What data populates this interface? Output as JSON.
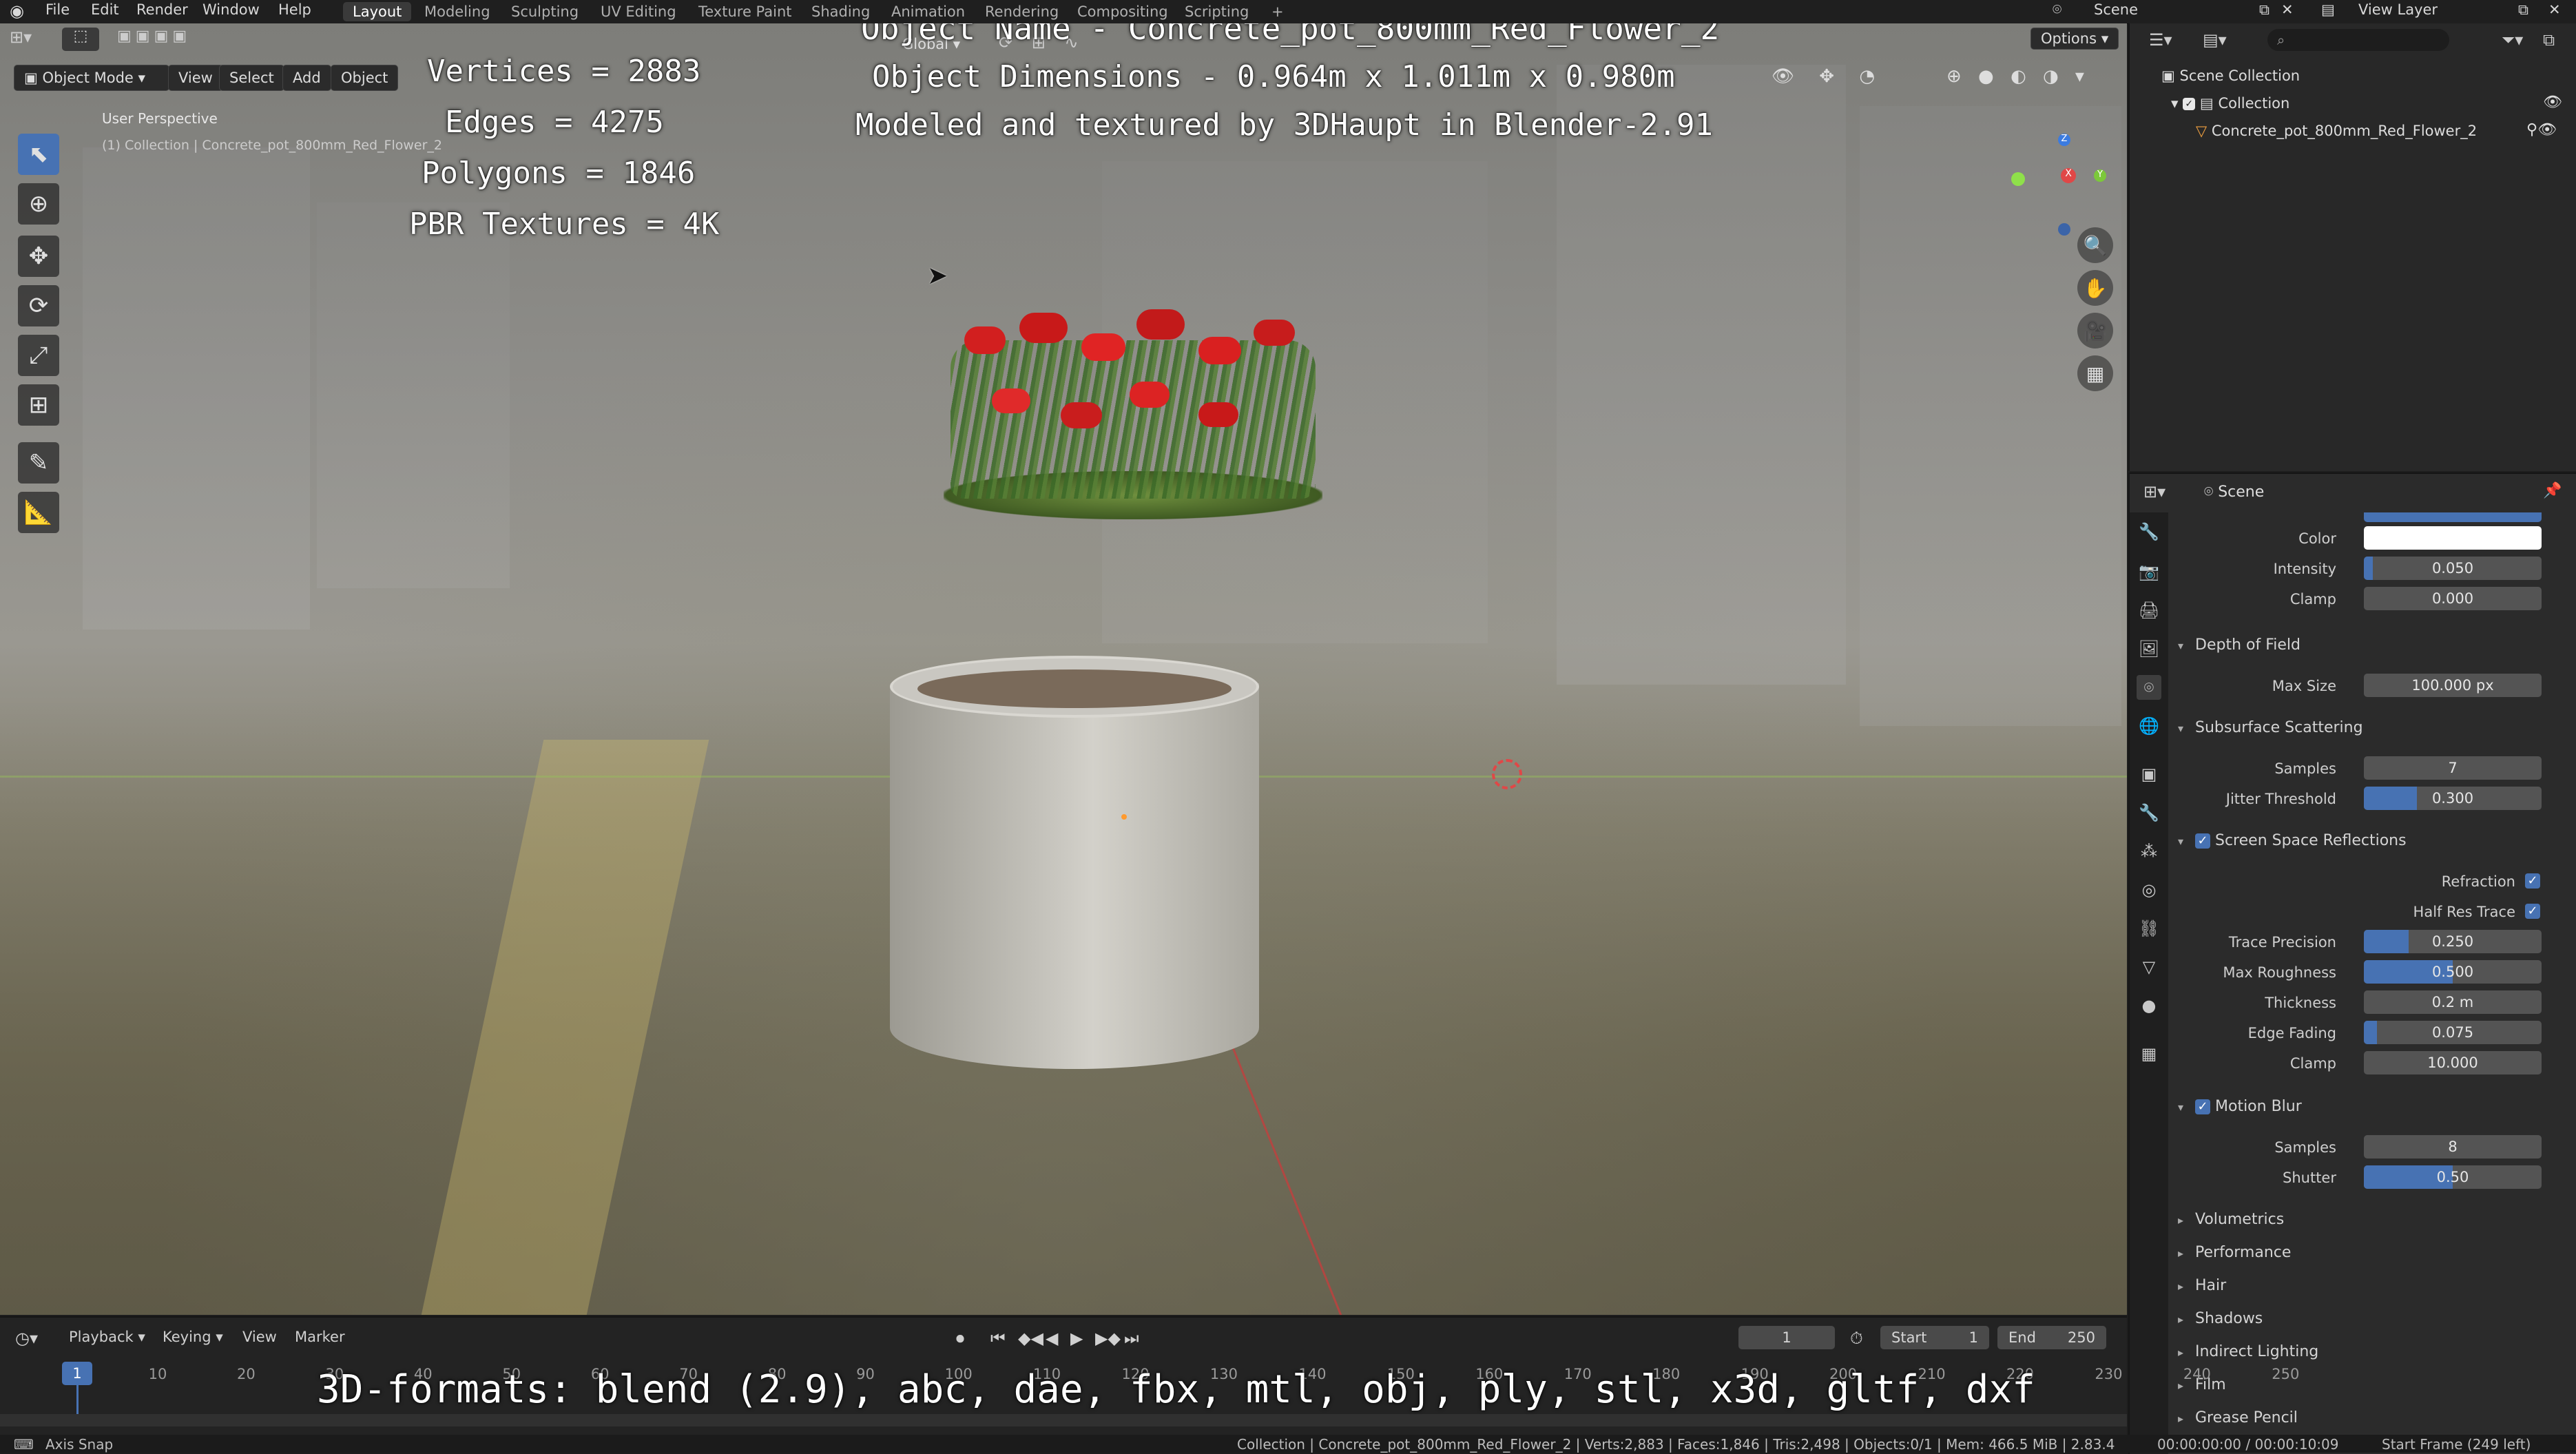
{
  "topbar": {
    "menus": [
      "File",
      "Edit",
      "Render",
      "Window",
      "Help"
    ],
    "workspaces": [
      "Layout",
      "Modeling",
      "Sculpting",
      "UV Editing",
      "Texture Paint",
      "Shading",
      "Animation",
      "Rendering",
      "Compositing",
      "Scripting"
    ],
    "active_workspace": "Layout",
    "add_tab": "+",
    "scene_label": "Scene",
    "view_layer_label": "View Layer"
  },
  "viewport": {
    "mode": "Object Mode",
    "header_menus": [
      "View",
      "Select",
      "Add",
      "Object"
    ],
    "transform_orientation": "Global",
    "options_label": "Options",
    "perspective_label": "User Perspective",
    "collection_label": "(1) Collection | Concrete_pot_800mm_Red_Flower_2",
    "gizmo": {
      "z": "Z",
      "x": "X",
      "y": "Y"
    }
  },
  "overlay": {
    "vertices": "Vertices = 2883",
    "edges": "Edges = 4275",
    "polygons": "Polygons = 1846",
    "pbr": "PBR Textures = 4K",
    "object_name": "Object Name - Concrete_pot_800mm_Red_Flower_2",
    "dimensions": "Object Dimensions -  0.964m x 1.011m x 0.980m",
    "credit": "Modeled and textured by 3DHaupt in Blender-2.91",
    "formats": "3D-formats: blend (2.9), abc, dae, fbx, mtl, obj, ply, stl, x3d, gltf, dxf"
  },
  "outliner": {
    "scene_collection": "Scene Collection",
    "collection": "Collection",
    "object": "Concrete_pot_800mm_Red_Flower_2"
  },
  "properties": {
    "context": "Scene",
    "color_label": "Color",
    "intensity_label": "Intensity",
    "intensity": "0.050",
    "intensity_fill": 0.05,
    "clamp_label": "Clamp",
    "clamp": "0.000",
    "dof_title": "Depth of Field",
    "max_size_label": "Max Size",
    "max_size": "100.000 px",
    "sss_title": "Subsurface Scattering",
    "samples_label": "Samples",
    "sss_samples": "7",
    "jitter_label": "Jitter Threshold",
    "jitter": "0.300",
    "jitter_fill": 0.3,
    "ssr_title": "Screen Space Reflections",
    "refraction_label": "Refraction",
    "half_res_label": "Half Res Trace",
    "trace_precision_label": "Trace Precision",
    "trace_precision": "0.250",
    "trace_precision_fill": 0.25,
    "max_roughness_label": "Max Roughness",
    "max_roughness": "0.500",
    "max_roughness_fill": 0.5,
    "thickness_label": "Thickness",
    "thickness": "0.2 m",
    "edge_fading_label": "Edge Fading",
    "edge_fading": "0.075",
    "edge_fading_fill": 0.075,
    "ssr_clamp": "10.000",
    "mb_title": "Motion Blur",
    "mb_samples": "8",
    "shutter_label": "Shutter",
    "shutter": "0.50",
    "shutter_fill": 0.5,
    "collapsed": [
      "Volumetrics",
      "Performance",
      "Hair",
      "Shadows",
      "Indirect Lighting",
      "Film",
      "Grease Pencil"
    ]
  },
  "timeline": {
    "menus": [
      "Playback",
      "Keying",
      "View",
      "Marker"
    ],
    "current_frame": "1",
    "start_label": "Start",
    "start": "1",
    "end_label": "End",
    "end": "250",
    "ticks": [
      "1",
      "10",
      "20",
      "30",
      "40",
      "50",
      "60",
      "70",
      "80",
      "90",
      "100",
      "110",
      "120",
      "130",
      "140",
      "150",
      "160",
      "170",
      "180",
      "190",
      "200",
      "210",
      "220",
      "230",
      "240",
      "250"
    ]
  },
  "status": {
    "left": "Axis Snap",
    "center": "Collection | Concrete_pot_800mm_Red_Flower_2 | Verts:2,883 | Faces:1,846 | Tris:2,498 | Objects:0/1 | Mem: 466.5 MiB | 2.83.4",
    "right_time": "00:00:00:00 / 00:00:10:09",
    "right_frame": "Start Frame (249 left)"
  },
  "colors": {
    "accent": "#4772b3",
    "flower": "#d21f1f"
  }
}
